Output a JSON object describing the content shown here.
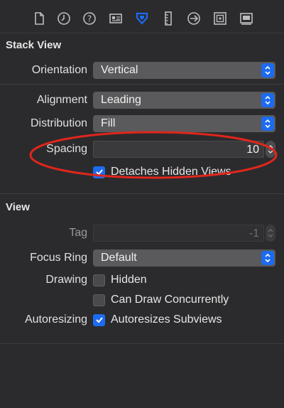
{
  "toolbar": {
    "tabs": [
      {
        "icon": "file-icon",
        "selected": false
      },
      {
        "icon": "clock-icon",
        "selected": false
      },
      {
        "icon": "help-icon",
        "selected": false
      },
      {
        "icon": "identity-icon",
        "selected": false
      },
      {
        "icon": "attributes-icon",
        "selected": true
      },
      {
        "icon": "ruler-icon",
        "selected": false
      },
      {
        "icon": "connections-icon",
        "selected": false
      },
      {
        "icon": "bindings-icon",
        "selected": false
      },
      {
        "icon": "effects-icon",
        "selected": false
      }
    ]
  },
  "stack_view": {
    "title": "Stack View",
    "orientation_label": "Orientation",
    "orientation_value": "Vertical",
    "alignment_label": "Alignment",
    "alignment_value": "Leading",
    "distribution_label": "Distribution",
    "distribution_value": "Fill",
    "spacing_label": "Spacing",
    "spacing_value": "10",
    "detaches_label": "Detaches Hidden Views",
    "detaches_checked": true
  },
  "view": {
    "title": "View",
    "tag_label": "Tag",
    "tag_value": "-1",
    "focus_ring_label": "Focus Ring",
    "focus_ring_value": "Default",
    "drawing_label": "Drawing",
    "hidden_label": "Hidden",
    "hidden_checked": false,
    "concurrent_label": "Can Draw Concurrently",
    "concurrent_checked": false,
    "autoresizing_label": "Autoresizing",
    "autoresizes_label": "Autoresizes Subviews",
    "autoresizes_checked": true
  },
  "colors": {
    "accent": "#1c6bf0",
    "annotation": "#e0261b",
    "background": "#2b2b2d"
  }
}
